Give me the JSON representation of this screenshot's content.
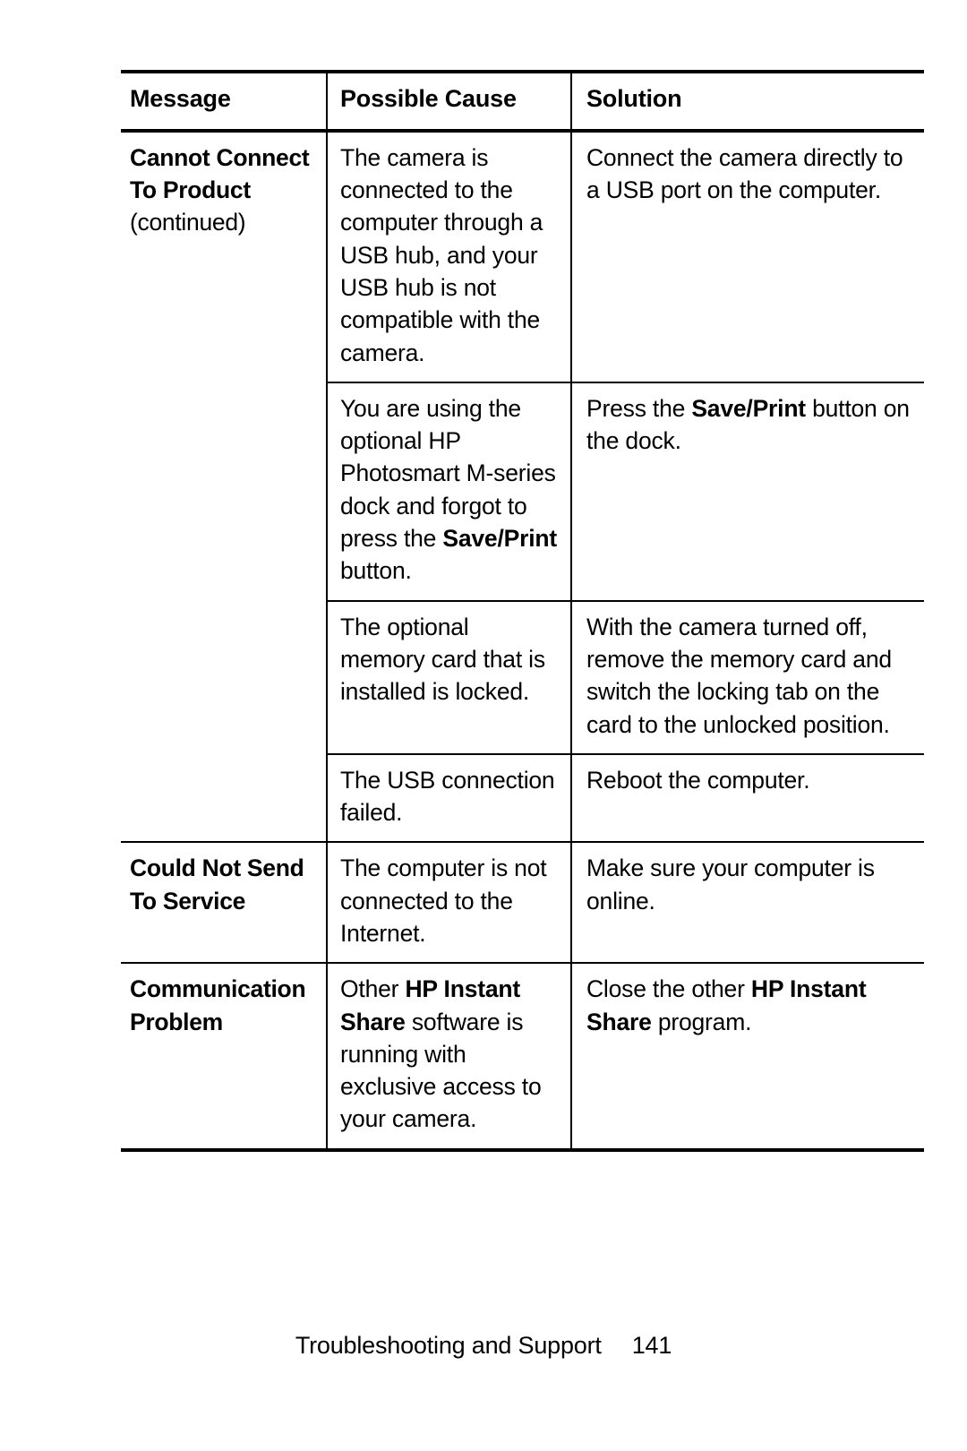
{
  "page": {
    "footer_title": "Troubleshooting and Support",
    "footer_page_number": "141",
    "text_color": "#000000",
    "background_color": "#ffffff",
    "rule_color": "#000000"
  },
  "table": {
    "headers": {
      "message": "Message",
      "possible_cause": "Possible Cause",
      "solution": "Solution"
    },
    "rows": [
      {
        "message_bold_line1": "Cannot Connect",
        "message_bold_line2": "To Product",
        "message_normal_line3": "(continued)",
        "cause_text": "The camera is connected to the computer through a USB hub, and your USB hub is not compatible with the camera.",
        "solution_text": "Connect the camera directly to a USB port on the computer."
      },
      {
        "cause_pre": "You are using the optional HP Photosmart M-series dock and forgot to press the ",
        "cause_bold": "Save/Print",
        "cause_post": " button.",
        "solution_pre": "Press the ",
        "solution_bold": "Save/Print",
        "solution_post": " button on the dock."
      },
      {
        "cause_text": "The optional memory card that is installed is locked.",
        "solution_text": "With the camera turned off, remove the memory card and switch the locking tab on the card to the unlocked position."
      },
      {
        "cause_text": "The USB connection failed.",
        "solution_text": "Reboot the computer."
      },
      {
        "message_bold_line1": "Could Not Send",
        "message_bold_line2": "To Service",
        "cause_text": "The computer is not connected to the Internet.",
        "solution_text": "Make sure your computer is online."
      },
      {
        "message_bold_line1": "Communication",
        "message_bold_line2": "Problem",
        "cause_pre": "Other ",
        "cause_bold": "HP Instant Share",
        "cause_post": " software is running with exclusive access to your camera.",
        "solution_pre": "Close the other ",
        "solution_bold": "HP Instant Share",
        "solution_post": " program."
      }
    ]
  }
}
